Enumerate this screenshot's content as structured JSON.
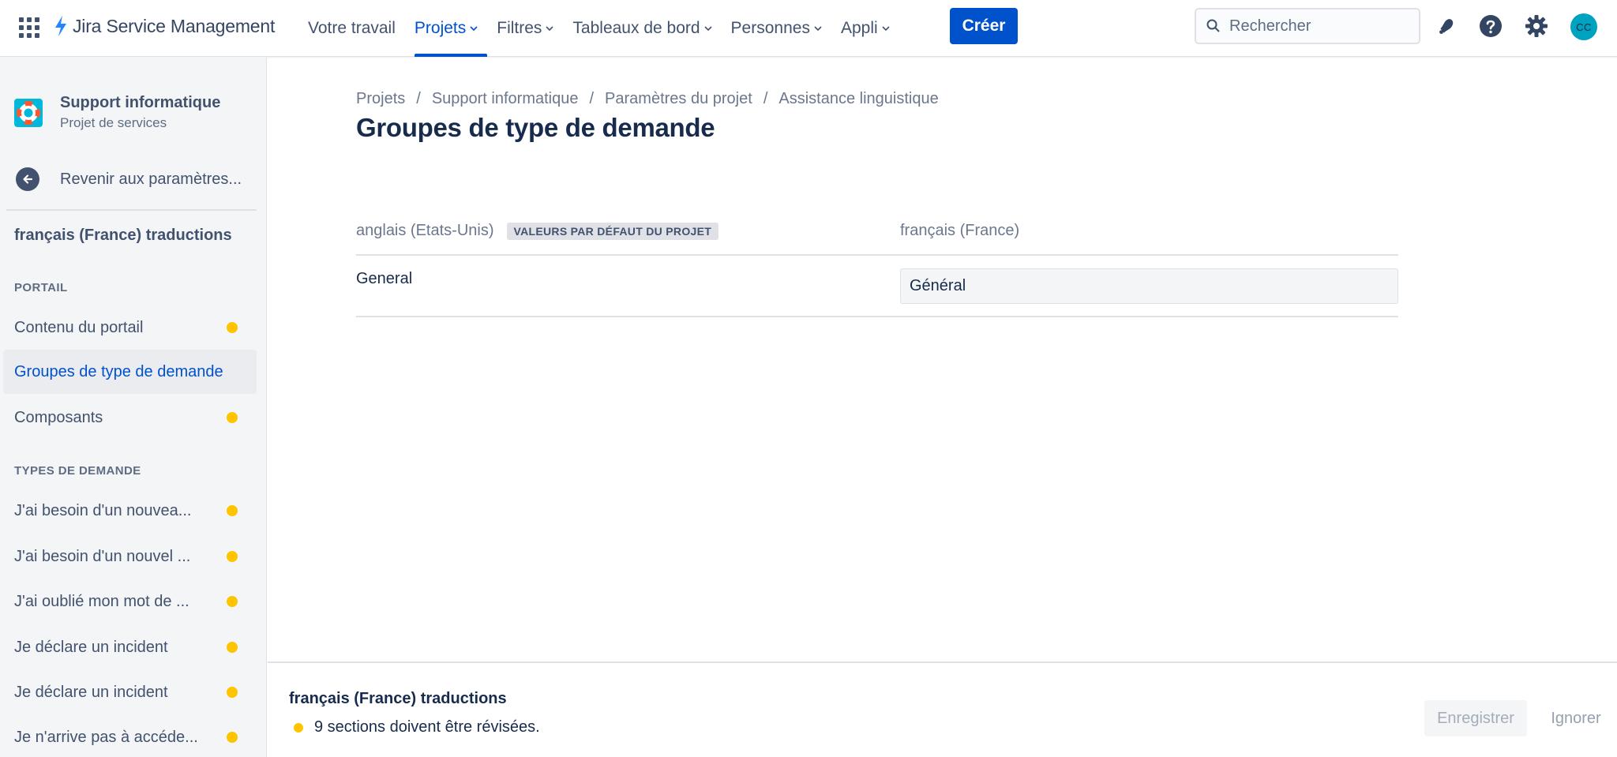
{
  "topnav": {
    "product": "Jira Service Management",
    "items": [
      {
        "label": "Votre travail",
        "dropdown": false,
        "active": false
      },
      {
        "label": "Projets",
        "dropdown": true,
        "active": true
      },
      {
        "label": "Filtres",
        "dropdown": true,
        "active": false
      },
      {
        "label": "Tableaux de bord",
        "dropdown": true,
        "active": false
      },
      {
        "label": "Personnes",
        "dropdown": true,
        "active": false
      },
      {
        "label": "Appli",
        "dropdown": true,
        "active": false
      }
    ],
    "create_label": "Créer",
    "search_placeholder": "Rechercher",
    "avatar_initials": "CC"
  },
  "sidebar": {
    "project_name": "Support informatique",
    "project_type": "Projet de services",
    "back_label": "Revenir aux paramètres...",
    "title": "français (France) traductions",
    "portal_section": "PORTAIL",
    "portal_items": [
      {
        "label": "Contenu du portail",
        "needs_review": true,
        "selected": false
      },
      {
        "label": "Groupes de type de demande",
        "needs_review": false,
        "selected": true
      },
      {
        "label": "Composants",
        "needs_review": true,
        "selected": false
      }
    ],
    "types_section": "TYPES DE DEMANDE",
    "type_items": [
      {
        "label": "J'ai besoin d'un nouvea...",
        "needs_review": true
      },
      {
        "label": "J'ai besoin d'un nouvel ...",
        "needs_review": true
      },
      {
        "label": "J'ai oublié mon mot de ...",
        "needs_review": true
      },
      {
        "label": "Je déclare un incident",
        "needs_review": true
      },
      {
        "label": "Je déclare un incident",
        "needs_review": true
      },
      {
        "label": "Je n'arrive pas à accéde...",
        "needs_review": true
      }
    ]
  },
  "main": {
    "breadcrumb": [
      "Projets",
      "Support informatique",
      "Paramètres du projet",
      "Assistance linguistique"
    ],
    "title": "Groupes de type de demande",
    "source_language": "anglais (Etats-Unis)",
    "default_badge": "VALEURS PAR DÉFAUT DU PROJET",
    "target_language": "français (France)",
    "rows": [
      {
        "source": "General",
        "translation": "Général"
      }
    ]
  },
  "bottom_bar": {
    "title": "français (France) traductions",
    "status": "9 sections doivent être révisées.",
    "save_label": "Enregistrer",
    "ignore_label": "Ignorer"
  },
  "colors": {
    "brand": "#0052CC",
    "warning_dot": "#FFC400",
    "avatar": "#00A3BF"
  }
}
